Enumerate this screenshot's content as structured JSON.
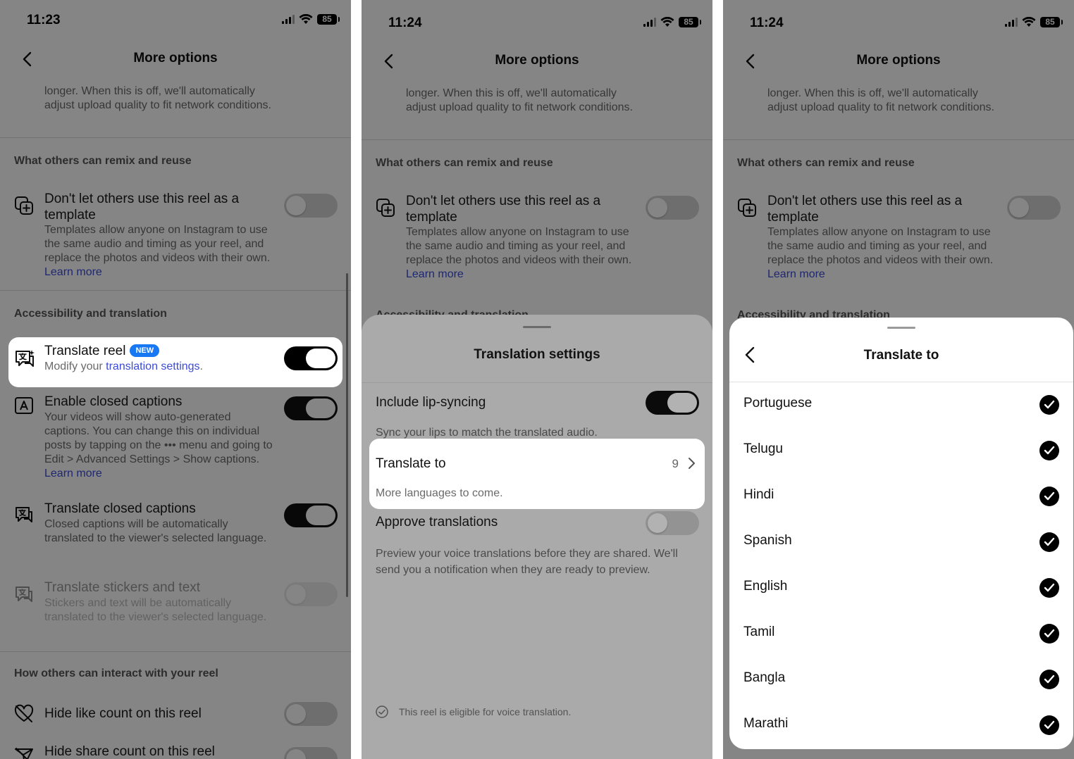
{
  "panel1": {
    "time": "11:23",
    "battery": "85",
    "title": "More options",
    "top_desc": "longer. When this is off, we'll automatically adjust upload quality to fit network conditions.",
    "section_remix": "What others can remix and reuse",
    "template_title": "Don't let others use this reel as a template",
    "template_desc": "Templates allow anyone on Instagram to use the same audio and timing as your reel, and replace the photos and videos with their own. ",
    "template_link": "Learn more",
    "section_access": "Accessibility and translation",
    "translate_reel_title": "Translate reel",
    "new_badge": "NEW",
    "translate_reel_desc": "Modify your ",
    "translate_reel_link": "translation settings",
    "translate_reel_after": ".",
    "captions_title": "Enable closed captions",
    "captions_desc": "Your videos will show auto-generated captions. You can change this on individual posts by tapping on the ••• menu and going to Edit > Advanced Settings > Show captions. ",
    "captions_link": "Learn more",
    "translate_captions_title": "Translate closed captions",
    "translate_captions_desc": "Closed captions will be automatically translated to the viewer's selected language.",
    "stickers_title": "Translate stickers and text",
    "stickers_desc": "Stickers and text will be automatically translated to the viewer's selected language.",
    "section_interact": "How others can interact with your reel",
    "hide_like_title": "Hide like count on this reel",
    "hide_share_title": "Hide share count on this reel"
  },
  "panel2": {
    "time": "11:24",
    "battery": "85",
    "title": "More options",
    "top_desc": "longer. When this is off, we'll automatically adjust upload quality to fit network conditions.",
    "section_remix": "What others can remix and reuse",
    "template_title": "Don't let others use this reel as a template",
    "template_desc": "Templates allow anyone on Instagram to use the same audio and timing as your reel, and replace the photos and videos with their own. ",
    "template_link": "Learn more",
    "section_access": "Accessibility and translation",
    "sheet_title": "Translation settings",
    "lip_title": "Include lip-syncing",
    "lip_desc": "Sync your lips to match the translated audio.",
    "translate_to_title": "Translate to",
    "translate_to_count": "9",
    "translate_to_desc": "More languages to come.",
    "approve_title": "Approve translations",
    "approve_desc": "Preview your voice translations before they are shared. We'll send you a notification when they are ready to preview.",
    "eligible_text": "This reel is eligible for voice translation."
  },
  "panel3": {
    "time": "11:24",
    "battery": "85",
    "title": "More options",
    "top_desc": "longer. When this is off, we'll automatically adjust upload quality to fit network conditions.",
    "section_remix": "What others can remix and reuse",
    "template_title": "Don't let others use this reel as a template",
    "template_desc": "Templates allow anyone on Instagram to use the same audio and timing as your reel, and replace the photos and videos with their own. ",
    "template_link": "Learn more",
    "section_access": "Accessibility and translation",
    "sheet_title": "Translate to",
    "languages": [
      "Portuguese",
      "Telugu",
      "Hindi",
      "Spanish",
      "English",
      "Tamil",
      "Bangla",
      "Marathi"
    ]
  },
  "colors": {
    "link": "#3b4bd8",
    "badge": "#1877f2",
    "overlay": "rgba(0,0,0,0.48)"
  }
}
